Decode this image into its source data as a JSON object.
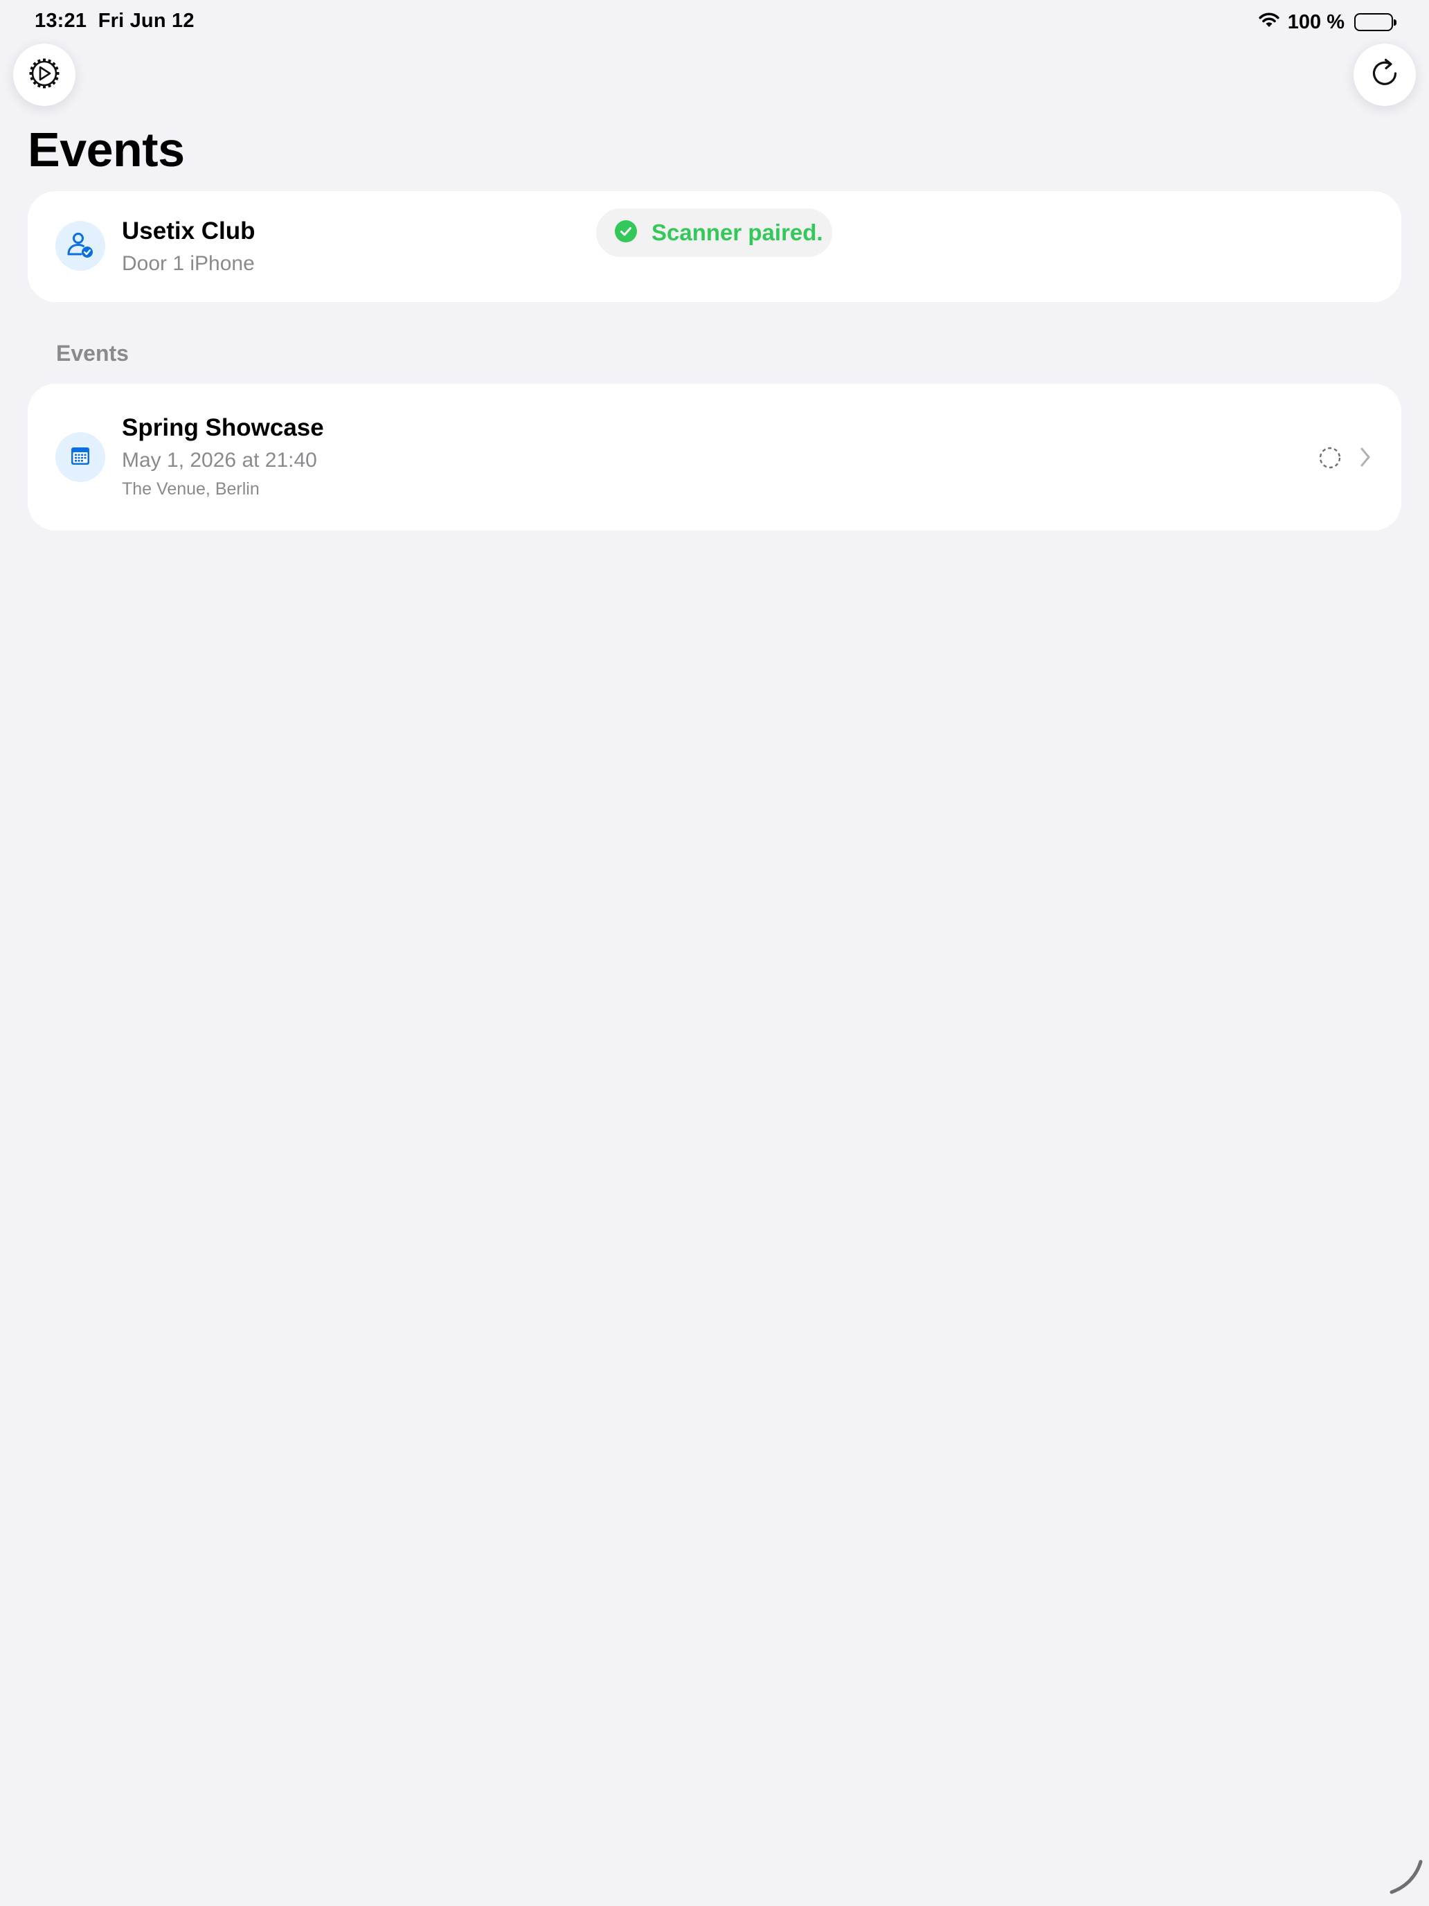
{
  "status_bar": {
    "time": "13:21",
    "date": "Fri Jun 12",
    "battery": "100 %",
    "wifi_icon": "wifi-icon",
    "battery_icon": "battery-icon"
  },
  "header": {
    "title": "Events",
    "settings_icon": "gear-icon",
    "refresh_icon": "refresh-icon"
  },
  "account": {
    "name": "Usetix Club",
    "device": "Door 1 iPhone",
    "icon": "person-check-icon"
  },
  "toast": {
    "message": "Scanner paired.",
    "icon": "checkmark-circle-icon",
    "color": "#34c759"
  },
  "events_section": {
    "header": "Events",
    "items": [
      {
        "title": "Spring Showcase",
        "date": "May 1, 2026 at 21:40",
        "venue": "The Venue, Berlin",
        "icon": "calendar-icon",
        "status_icon": "dashed-circle-icon"
      }
    ]
  },
  "colors": {
    "background": "#f2f2f7",
    "accent": "#0a84ff",
    "success": "#34c759",
    "secondary_text": "#8a8a8e"
  }
}
